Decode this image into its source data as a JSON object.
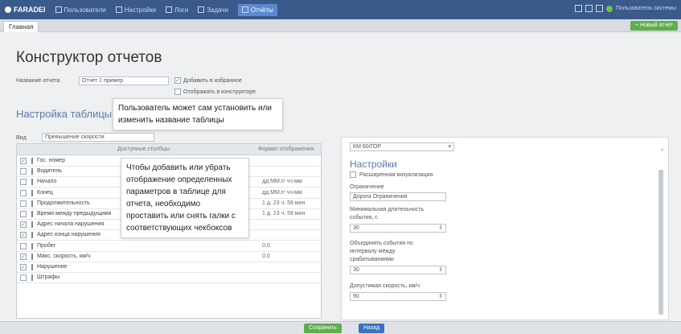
{
  "app": {
    "logo": "FARADEI",
    "user": "Пользователь системы"
  },
  "nav": [
    {
      "label": "Пользователи"
    },
    {
      "label": "Настройки"
    },
    {
      "label": "Логи"
    },
    {
      "label": "Задачи"
    },
    {
      "label": "Отчёты"
    }
  ],
  "tab": {
    "label": "Главная"
  },
  "new_button": "+ Новый отчет",
  "page": {
    "title": "Конструктор отчетов"
  },
  "form": {
    "name_label": "Название отчета",
    "name_value": "Отчет 1 пример",
    "cb_favorites": "Добавить в избранное",
    "cb_constructor": "Отображать в конструкторе"
  },
  "section_title": "Настройка таблицы",
  "tooltips": {
    "top": "Пользователь может сам установить или изменить название таблицы",
    "middle": "Чтобы добавить или убрать отображение определенных параметров в таблице для отчета, необходимо проставить или снять галки с соответствующих чекбоксов"
  },
  "table": {
    "view_label": "Вид",
    "view_value": "Превышение скорости",
    "col_param": "Доступные столбцы",
    "col_value": "Формат отображения",
    "rows": [
      {
        "checked": true,
        "name": "Гос. номер",
        "value": ""
      },
      {
        "checked": false,
        "name": "Водитель",
        "value": ""
      },
      {
        "checked": false,
        "name": "Начало",
        "value": "дд.ММ.гг чч:мм"
      },
      {
        "checked": false,
        "name": "Конец",
        "value": "дд.ММ.гг чч:мм"
      },
      {
        "checked": false,
        "name": "Продолжительность",
        "value": "1 д. 23 ч. 59 мин"
      },
      {
        "checked": false,
        "name": "Время между предыдущими",
        "value": "1 д. 23 ч. 59 мин"
      },
      {
        "checked": true,
        "name": "Адрес начала нарушения",
        "value": ""
      },
      {
        "checked": true,
        "name": "Адрес конца нарушения",
        "value": ""
      },
      {
        "checked": false,
        "name": "Пробег",
        "value": "0.0"
      },
      {
        "checked": true,
        "name": "Макс. скорость, км/ч",
        "value": "0.0"
      },
      {
        "checked": true,
        "name": "Нарушение",
        "value": ""
      },
      {
        "checked": false,
        "name": "Штрафы",
        "value": ""
      }
    ]
  },
  "settings": {
    "select_value": "КМ 60/ГОР",
    "title": "Настройки",
    "cb_extended": "Расширенная визуализация",
    "limit_label": "Ограничение",
    "limit_value": "Дорога Ограничения",
    "min_duration_label": "Минимальная длительность",
    "min_duration_label2": "события, с",
    "min_duration_value": "30",
    "merge_label": "Объединять события по",
    "merge_label2": "интервалу между",
    "merge_label3": "срабатываниями",
    "merge_value": "30",
    "speed_label": "Допустимая скорость, км/ч",
    "speed_value": "90"
  },
  "buttons": {
    "save": "Сохранить",
    "cancel": "Назад"
  }
}
